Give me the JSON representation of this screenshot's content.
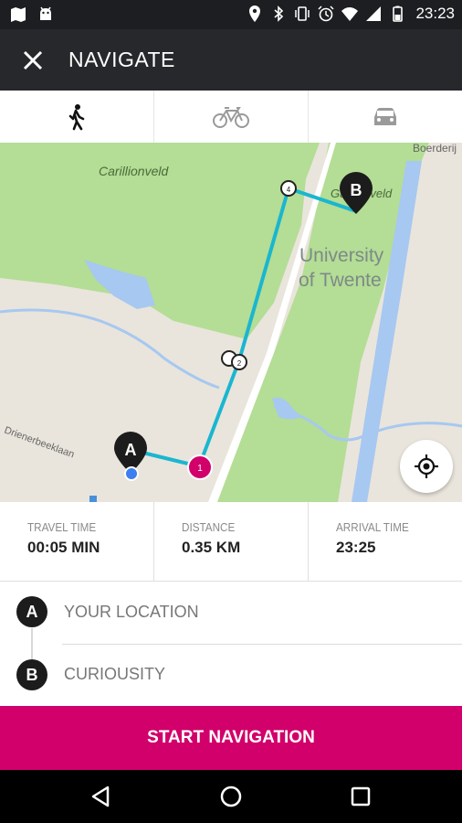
{
  "status_bar": {
    "time": "23:23",
    "icons": [
      "map-icon",
      "android-icon",
      "location-icon",
      "bluetooth-icon",
      "vibrate-icon",
      "alarm-icon",
      "wifi-icon",
      "signal-icon",
      "battery-icon"
    ]
  },
  "app_bar": {
    "title": "NAVIGATE",
    "close_icon": "close-icon"
  },
  "travel_modes": [
    {
      "name": "walk",
      "icon": "walk-icon",
      "selected": true
    },
    {
      "name": "bike",
      "icon": "bike-icon",
      "selected": false
    },
    {
      "name": "car",
      "icon": "car-icon",
      "selected": false
    }
  ],
  "map": {
    "labels": {
      "carillionveld": "Carillionveld",
      "university_line1": "University",
      "university_line2": "of Twente",
      "boerderij": "Boerderij",
      "gardenveld": "Gardenveld",
      "drienerbeek": "Drienerbeeklaan"
    },
    "markers": {
      "start": "A",
      "end": "B",
      "waypoint_1": "1",
      "waypoint_2": "2",
      "waypoint_4": "4"
    },
    "route_color": "#1ab6d0",
    "marker_color": "#d1006b"
  },
  "stats": {
    "travel_time_label": "TRAVEL TIME",
    "travel_time_value": "00:05 MIN",
    "distance_label": "DISTANCE",
    "distance_value": "0.35 KM",
    "arrival_label": "ARRIVAL TIME",
    "arrival_value": "23:25"
  },
  "route": {
    "from_marker": "A",
    "from_label": "YOUR LOCATION",
    "to_marker": "B",
    "to_label": "CURIOUSITY"
  },
  "start_button": {
    "label": "START NAVIGATION",
    "color": "#d1006b"
  },
  "nav_bar": {
    "icons": [
      "back-icon",
      "home-icon",
      "recents-icon"
    ]
  }
}
